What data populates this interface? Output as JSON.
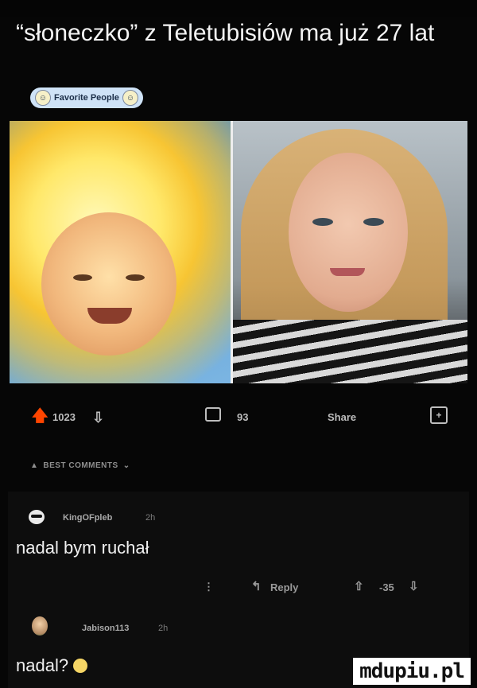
{
  "post": {
    "title": "“słoneczko” z Teletubisiów ma już 27 lat",
    "flair": {
      "label": "Favorite People",
      "icon_left": "smiley-face-icon",
      "icon_right": "smiley-face-icon"
    },
    "images": [
      {
        "icon": "sun-baby-photo"
      },
      {
        "icon": "woman-portrait-photo"
      }
    ]
  },
  "actions": {
    "upvotes": "1023",
    "comments": "93",
    "share_label": "Share",
    "upvote_color": "#ff4500"
  },
  "comments_header": {
    "label": "BEST COMMENTS",
    "chevron": "⌄"
  },
  "comments": [
    {
      "user": "KingOFpleb",
      "time": "2h",
      "text": "nadal bym ruchał",
      "more": "⋮",
      "reply_label": "Reply",
      "score": "-35"
    },
    {
      "user": "Jabison113",
      "time": "2h",
      "text": "nadal?"
    }
  ],
  "watermark": "mdupiu.pl"
}
